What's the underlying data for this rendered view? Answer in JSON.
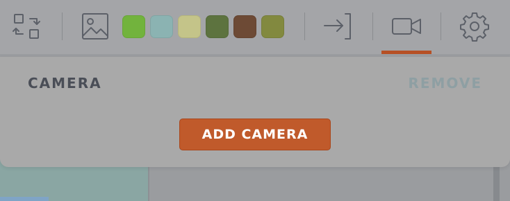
{
  "toolbar": {
    "tools": [
      {
        "name": "swap-layout-icon",
        "active": false
      },
      {
        "name": "image-icon",
        "active": false
      },
      {
        "name": "enter-icon",
        "active": false
      },
      {
        "name": "video-camera-icon",
        "active": true
      },
      {
        "name": "gear-icon",
        "active": false
      }
    ],
    "swatches": [
      "#72b33d",
      "#8bb3b2",
      "#c4c489",
      "#5d733f",
      "#6d4a35",
      "#82893f"
    ],
    "icon_color": "#5c6068",
    "active_color": "#b65025"
  },
  "panel": {
    "title": "CAMERA",
    "remove_label": "REMOVE",
    "remove_color": "#8e9fa3",
    "add_button_label": "ADD CAMERA",
    "add_button_color": "#c05a2b"
  }
}
